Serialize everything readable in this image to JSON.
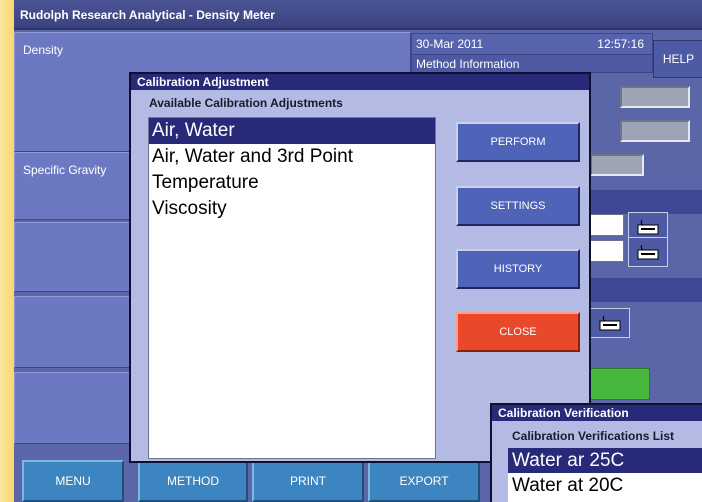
{
  "window": {
    "title": "Rudolph Research Analytical - Density Meter"
  },
  "panels": {
    "density_label": "Density",
    "specific_gravity_label": "Specific Gravity"
  },
  "info": {
    "date": "30-Mar 2011",
    "time": "12:57:16",
    "method_label": "Method Information"
  },
  "help_label": "HELP",
  "bottom_menu": {
    "menu": "MENU",
    "method": "METHOD",
    "print": "PRINT",
    "export": "EXPORT"
  },
  "calibration_adjustment": {
    "title": "Calibration Adjustment",
    "subtitle": "Available Calibration Adjustments",
    "items": [
      "Air, Water",
      "Air, Water and 3rd Point",
      "Temperature",
      "Viscosity"
    ],
    "selected_index": 0,
    "buttons": {
      "perform": "PERFORM",
      "settings": "SETTINGS",
      "history": "HISTORY",
      "close": "CLOSE"
    }
  },
  "calibration_verification": {
    "title": "Calibration Verification",
    "subtitle": "Calibration Verifications List",
    "items": [
      "Water ar 25C",
      "Water at 20C"
    ],
    "selected_index": 0
  },
  "colors": {
    "background": "#5b66a8",
    "panel": "#6c78c2",
    "dialog": "#b3bae4",
    "title_bar": "#262a78",
    "close_button": "#e9482a",
    "status_green": "#47b83b",
    "menu_button": "#3d85c0"
  },
  "icons": {
    "keyboard": "keyboard-icon"
  }
}
